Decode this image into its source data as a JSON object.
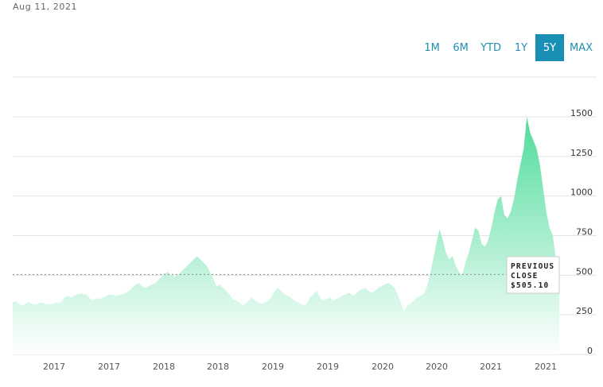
{
  "header": {
    "date": "Aug 11, 2021"
  },
  "ranges": [
    {
      "label": "1M",
      "active": false
    },
    {
      "label": "6M",
      "active": false
    },
    {
      "label": "YTD",
      "active": false
    },
    {
      "label": "1Y",
      "active": false
    },
    {
      "label": "5Y",
      "active": true
    },
    {
      "label": "MAX",
      "active": false
    }
  ],
  "tooltip": {
    "line1": "PREVIOUS",
    "line2": "CLOSE",
    "line3": "$505.10"
  },
  "colors": {
    "accent": "#1a8fb5",
    "area_top": "#4fdc9b",
    "area_bottom": "#ffffff"
  },
  "chart_data": {
    "type": "area",
    "ylim": [
      0,
      1500
    ],
    "yticks": [
      "0",
      "250",
      "500",
      "750",
      "1000",
      "1250",
      "1500"
    ],
    "xtick_labels": [
      "2017",
      "2017",
      "2018",
      "2018",
      "2019",
      "2019",
      "2020",
      "2020",
      "2021",
      "2021"
    ],
    "previous_close": 505.1,
    "series": [
      {
        "values": [
          330,
          335,
          315,
          310,
          320,
          330,
          320,
          315,
          320,
          330,
          320,
          315,
          318,
          325,
          325,
          330,
          360,
          370,
          360,
          370,
          380,
          385,
          380,
          375,
          350,
          345,
          355,
          350,
          360,
          370,
          380,
          375,
          370,
          375,
          380,
          390,
          400,
          420,
          440,
          450,
          430,
          420,
          430,
          440,
          450,
          470,
          490,
          510,
          520,
          500,
          490,
          500,
          520,
          540,
          560,
          580,
          600,
          620,
          600,
          580,
          560,
          520,
          480,
          430,
          440,
          420,
          400,
          380,
          350,
          340,
          330,
          310,
          320,
          340,
          360,
          340,
          330,
          320,
          330,
          340,
          360,
          400,
          420,
          400,
          380,
          370,
          360,
          340,
          330,
          320,
          310,
          320,
          360,
          380,
          400,
          360,
          340,
          350,
          360,
          340,
          350,
          360,
          370,
          380,
          390,
          370,
          380,
          400,
          410,
          420,
          400,
          390,
          400,
          420,
          430,
          440,
          450,
          440,
          420,
          380,
          330,
          270,
          310,
          320,
          340,
          360,
          370,
          380,
          420,
          500,
          600,
          700,
          790,
          720,
          640,
          600,
          620,
          560,
          520,
          500,
          580,
          640,
          720,
          800,
          780,
          700,
          680,
          720,
          800,
          900,
          980,
          1000,
          880,
          860,
          900,
          980,
          1100,
          1200,
          1300,
          1500,
          1400,
          1350,
          1300,
          1200,
          1050,
          900,
          800,
          750,
          600,
          505
        ]
      }
    ]
  }
}
